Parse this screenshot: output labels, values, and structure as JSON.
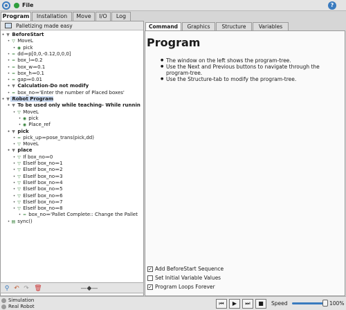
{
  "app": {
    "menu_label": "File"
  },
  "main_tabs": [
    "Program",
    "Installation",
    "Move",
    "I/O",
    "Log"
  ],
  "left_panel": {
    "header": "Palletizing made easy"
  },
  "tree": [
    {
      "label": "BeforeStart",
      "depth": 0,
      "icon": "triangle-down",
      "bold": true
    },
    {
      "label": "MoveL",
      "depth": 1,
      "icon": "move"
    },
    {
      "label": "pick",
      "depth": 2,
      "icon": "waypoint"
    },
    {
      "label": "dd≔p[0,0,-0.12,0,0,0]",
      "depth": 1,
      "icon": "assign"
    },
    {
      "label": "box_l≔0.2",
      "depth": 1,
      "icon": "assign"
    },
    {
      "label": "box_w≔0.1",
      "depth": 1,
      "icon": "assign"
    },
    {
      "label": "box_h≔0.1",
      "depth": 1,
      "icon": "assign"
    },
    {
      "label": "gap≔0.01",
      "depth": 1,
      "icon": "assign"
    },
    {
      "label": "Calculation-Do not modify",
      "depth": 1,
      "icon": "triangle-down",
      "bold": true
    },
    {
      "label": "box_no≔'Enter the number of Placed boxes'",
      "depth": 1,
      "icon": "assign"
    },
    {
      "label": "Robot Program",
      "depth": 0,
      "icon": "triangle-down",
      "bold": true,
      "selected": true
    },
    {
      "label": "To be used only while teaching- While runnin",
      "depth": 1,
      "icon": "triangle-down",
      "bold": true
    },
    {
      "label": "MoveL",
      "depth": 2,
      "icon": "move"
    },
    {
      "label": "pick",
      "depth": 3,
      "icon": "waypoint"
    },
    {
      "label": "Place_ref",
      "depth": 3,
      "icon": "waypoint"
    },
    {
      "label": "pick",
      "depth": 1,
      "icon": "triangle-down",
      "bold": true
    },
    {
      "label": "pick_up≔pose_trans(pick,dd)",
      "depth": 2,
      "icon": "assign"
    },
    {
      "label": "MoveL",
      "depth": 2,
      "icon": "move"
    },
    {
      "label": "place",
      "depth": 1,
      "icon": "triangle-down",
      "bold": true
    },
    {
      "label": "If box_no≔0",
      "depth": 2,
      "icon": "if"
    },
    {
      "label": "ElseIf box_no≔1",
      "depth": 2,
      "icon": "if"
    },
    {
      "label": "ElseIf box_no≔2",
      "depth": 2,
      "icon": "if"
    },
    {
      "label": "ElseIf box_no≔3",
      "depth": 2,
      "icon": "if"
    },
    {
      "label": "ElseIf box_no≔4",
      "depth": 2,
      "icon": "if"
    },
    {
      "label": "ElseIf box_no≔5",
      "depth": 2,
      "icon": "if"
    },
    {
      "label": "ElseIf box_no≔6",
      "depth": 2,
      "icon": "if"
    },
    {
      "label": "ElseIf box_no≔7",
      "depth": 2,
      "icon": "if"
    },
    {
      "label": "ElseIf box_no≔8",
      "depth": 2,
      "icon": "if"
    },
    {
      "label": "box_no≔'Pallet Complete:: Change the Pallet",
      "depth": 3,
      "icon": "assign"
    },
    {
      "label": "sync()",
      "depth": 1,
      "icon": "script"
    }
  ],
  "right_tabs": [
    "Command",
    "Graphics",
    "Structure",
    "Variables"
  ],
  "program": {
    "title": "Program",
    "bullets": [
      "The window on the left shows the program-tree.",
      "Use the Next and Previous buttons to navigate through the program-tree.",
      "Use the Structure-tab to modify the program-tree."
    ],
    "options": [
      {
        "label": "Add BeforeStart Sequence",
        "checked": true
      },
      {
        "label": "Set Initial Variable Values",
        "checked": false
      },
      {
        "label": "Program Loops Forever",
        "checked": true
      }
    ]
  },
  "status": {
    "modes": [
      "Simulation",
      "Real Robot"
    ],
    "speed_label": "Speed",
    "speed_value": "100%",
    "speed_fraction": 1.0
  }
}
